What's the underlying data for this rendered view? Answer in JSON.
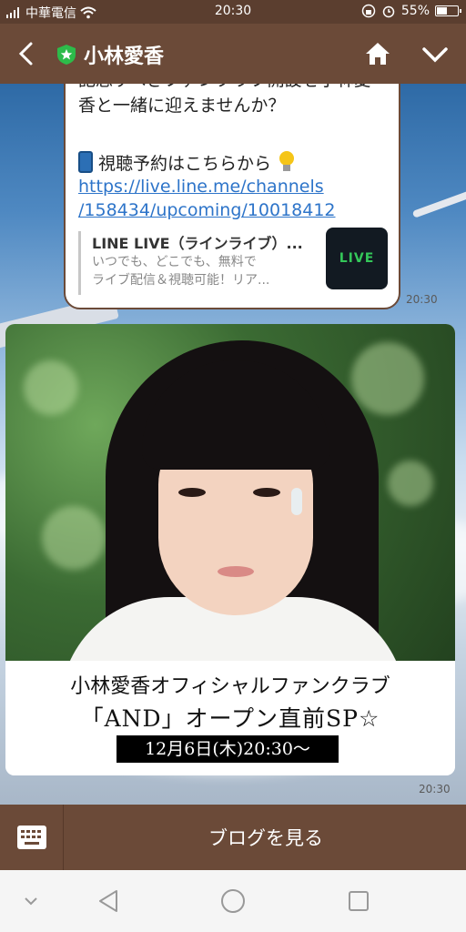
{
  "status_bar": {
    "carrier": "中華電信",
    "time": "20:30",
    "battery": "55%",
    "battery_level": 0.55,
    "icons": [
      "signal-icon",
      "wifi-icon",
      "rotation-lock-icon",
      "alarm-icon",
      "battery-icon"
    ]
  },
  "header": {
    "title": "小林愛香",
    "official_badge": "shield-star-icon",
    "buttons": [
      "back-icon",
      "home-icon",
      "chevron-down-icon"
    ]
  },
  "message1": {
    "text_lines": [
      "記念すべきファンクラブ開設を小林愛",
      "香と一緒に迎えませんか？"
    ],
    "reserve_text": "視聴予約はこちらから",
    "link_lines": [
      "https://live.line.me/channels",
      "/158434/upcoming/10018412"
    ],
    "preview": {
      "title": "LINE LIVE（ラインライブ）...",
      "desc_lines": [
        "いつでも、どこでも、無料で",
        "ライブ配信＆視聴可能！リア..."
      ],
      "thumb_text": "LIVE"
    },
    "time": "20:30"
  },
  "message2": {
    "caption_line1": "小林愛香オフィシャルファンクラブ",
    "caption_line2": "「AND」オープン直前SP☆",
    "caption_date": "12月6日(木)20:30〜",
    "time": "20:30"
  },
  "bottom_bar": {
    "blog_button": "ブログを見る",
    "keyboard_icon": "keyboard-icon"
  },
  "nav_bar": {
    "icons": [
      "nav-collapse-icon",
      "nav-back-icon",
      "nav-home-icon",
      "nav-recents-icon"
    ]
  },
  "colors": {
    "header": "#6b4a38",
    "status_bar": "#5b3e2f",
    "link": "#2d74c9",
    "live_green": "#34c759",
    "badge_green": "#2dbb4a"
  }
}
